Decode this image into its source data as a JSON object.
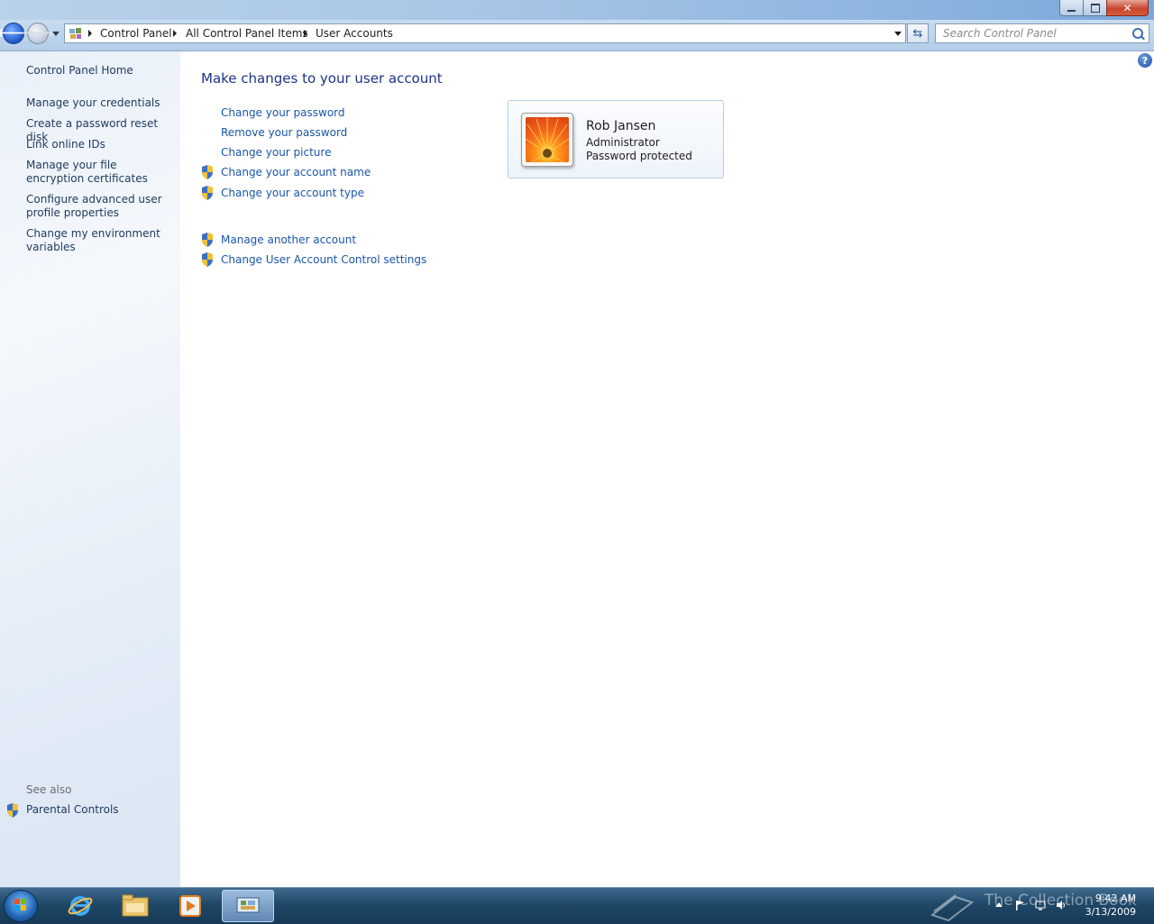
{
  "breadcrumb": [
    "Control Panel",
    "All Control Panel Items",
    "User Accounts"
  ],
  "search": {
    "placeholder": "Search Control Panel"
  },
  "left_pane": {
    "home": "Control Panel Home",
    "links": [
      "Manage your credentials",
      "Create a password reset disk",
      "Link online IDs",
      "Manage your file encryption certificates",
      "Configure advanced user profile properties",
      "Change my environment variables"
    ],
    "see_also_label": "See also",
    "see_also_link": "Parental Controls"
  },
  "main": {
    "title": "Make changes to your user account",
    "tasks": [
      {
        "label": "Change your password",
        "shield": false
      },
      {
        "label": "Remove your password",
        "shield": false
      },
      {
        "label": "Change your picture",
        "shield": false
      },
      {
        "label": "Change your account name",
        "shield": true
      },
      {
        "label": "Change your account type",
        "shield": true
      }
    ],
    "other_tasks": [
      {
        "label": "Manage another account",
        "shield": true
      },
      {
        "label": "Change User Account Control settings",
        "shield": true
      }
    ]
  },
  "user": {
    "name": "Rob Jansen",
    "role": "Administrator",
    "status": "Password protected"
  },
  "taskbar": {
    "time": "9:42 AM",
    "date": "3/13/2009",
    "watermark": "The Collection Book"
  },
  "colors": {
    "link": "#1a56a8",
    "title": "#1e3287",
    "left_pane_bg": "#e3ecf7",
    "taskbar": "#1f4766"
  }
}
